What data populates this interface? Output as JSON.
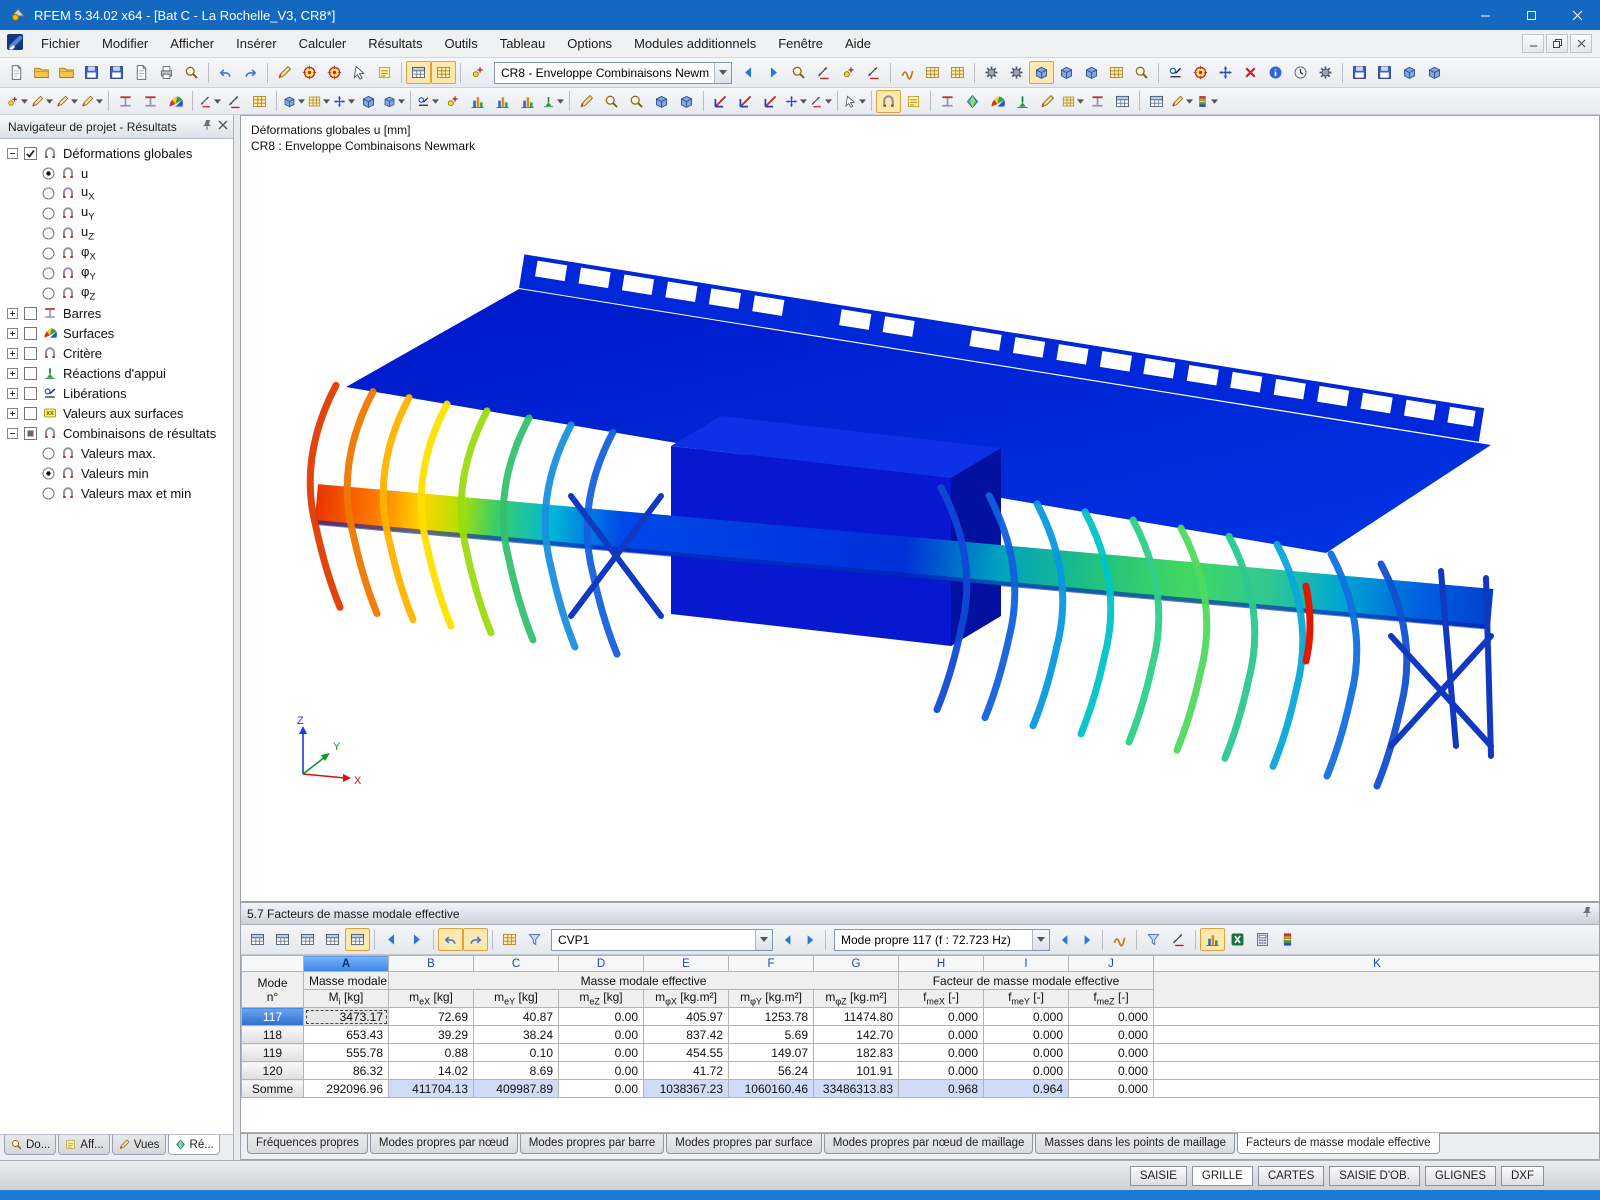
{
  "window": {
    "title": "RFEM 5.34.02 x64 - [Bat C - La Rochelle_V3, CR8*]"
  },
  "menu": {
    "items": [
      "Fichier",
      "Modifier",
      "Afficher",
      "Insérer",
      "Calculer",
      "Résultats",
      "Outils",
      "Tableau",
      "Options",
      "Modules additionnels",
      "Fenêtre",
      "Aide"
    ]
  },
  "toolbar_main": {
    "combo_value": "CR8 - Enveloppe Combinaisons Newm",
    "groups_left": [
      [
        "new-file|doc",
        "open-project|folder",
        "open-model|folder",
        "save-as|disk",
        "save|disk",
        "copy-clipboard|doc",
        "print|print",
        "print-preview|mag"
      ],
      [
        "undo|undo",
        "redo|redo"
      ],
      [
        "edit-geometry|pen",
        "zoom-by-click|target",
        "extreme-value|target",
        "select-special|cursor",
        "new-comment|note"
      ],
      [
        "show-tables|tbl|s",
        "show-grid-table|grid|s"
      ],
      [
        "regenerate-numbering|nodeP"
      ]
    ],
    "groups_right": [
      [
        "previous-load-case|navL",
        "next-load-case|navR",
        "search-object|mag",
        "extreme-values|dim",
        "snap-point|nodeP",
        "decimal-places|dim"
      ],
      [
        "result-diagrams|wave",
        "member-abacus|grid",
        "node-abacus|grid"
      ],
      [
        "generate-mesh|gear",
        "mesh-settings|gear",
        "show-mesh|cube|s",
        "mesh-quality|cube",
        "mesh-refinement|cube",
        "mesh-table|grid",
        "mesh-view|mag"
      ],
      [
        "measure|rel",
        "rotate-view|target",
        "mirror-model|move",
        "delete-results|xred",
        "model-info|info",
        "calculation-time|clockP",
        "calculation-parameters|gear"
      ],
      [
        "export-dxf|disk",
        "export-ifc|disk",
        "import-dxf|cube",
        "export-pdf|cube"
      ]
    ]
  },
  "toolbar_second": {
    "groups": [
      [
        "new-node|nodeP|d",
        "new-line|pen|d",
        "new-line-refined|pen|d",
        "new-polyline|pen|d"
      ],
      [
        "new-member|beam",
        "new-member-set|beam",
        "new-surface-member|fan"
      ],
      [
        "new-support|dim|d",
        "new-dimension|dim",
        "new-edit-frame|grid"
      ],
      [
        "new-surface|cube|d",
        "new-rect-surface|grid|d",
        "new-opening|move|d",
        "new-solid|cube",
        "new-block|cube|d"
      ],
      [
        "connect-members|rel|d",
        "insert-node|nodeP",
        "new-nodal-load|chart",
        "new-member-load|chart",
        "new-surface-load|chart",
        "generate-loads|supp|d"
      ],
      [
        "selection-brush|pen",
        "zoom-window|mag",
        "zoom-out|mag",
        "isometric-box|cube",
        "projection-box|cube"
      ],
      [
        "view-along-x|axx",
        "view-along-y|axx",
        "view-along-z|axx",
        "reverse-z-axis|move|d",
        "custom-view-angle|dim|d"
      ],
      [
        "grab-pan|cursor|d"
      ],
      [
        "show-results|arch|s",
        "result-values-beside|note"
      ],
      [
        "show-sections|beam",
        "color-kite|diam",
        "color-surfaces|fan",
        "show-supports|supp",
        "fly-through|pen",
        "partial-views|grid|d",
        "section-plane|beam",
        "result-beams|tbl"
      ],
      [
        "control-panel|tbl",
        "display-properties|pen|d",
        "color-scale|scale|d"
      ]
    ]
  },
  "navigator": {
    "title": "Navigateur de projet - Résultats",
    "tree": [
      {
        "label": "Déformations globales",
        "sub": "",
        "level": 0,
        "control": "checkbox",
        "state": "checked",
        "expander": "minus",
        "icon": "arch",
        "name": "tree-deformations-globales"
      },
      {
        "label": "u",
        "sub": "",
        "level": 1,
        "control": "radio",
        "state": "on",
        "icon": "arch",
        "name": "tree-u"
      },
      {
        "label": "u",
        "sub": "X",
        "level": 1,
        "control": "radio",
        "state": "off",
        "icon": "arch",
        "name": "tree-ux"
      },
      {
        "label": "u",
        "sub": "Y",
        "level": 1,
        "control": "radio",
        "state": "off",
        "icon": "arch",
        "name": "tree-uy"
      },
      {
        "label": "u",
        "sub": "Z",
        "level": 1,
        "control": "radio",
        "state": "off",
        "icon": "arch",
        "name": "tree-uz"
      },
      {
        "label": "φ",
        "sub": "X",
        "level": 1,
        "control": "radio",
        "state": "off",
        "icon": "arch",
        "name": "tree-phix"
      },
      {
        "label": "φ",
        "sub": "Y",
        "level": 1,
        "control": "radio",
        "state": "off",
        "icon": "arch",
        "name": "tree-phiy"
      },
      {
        "label": "φ",
        "sub": "Z",
        "level": 1,
        "control": "radio",
        "state": "off",
        "icon": "arch",
        "name": "tree-phiz"
      },
      {
        "label": "Barres",
        "sub": "",
        "level": 0,
        "control": "checkbox",
        "state": "off",
        "expander": "plus",
        "icon": "beam",
        "name": "tree-barres"
      },
      {
        "label": "Surfaces",
        "sub": "",
        "level": 0,
        "control": "checkbox",
        "state": "off",
        "expander": "plus",
        "icon": "fan",
        "name": "tree-surfaces"
      },
      {
        "label": "Critère",
        "sub": "",
        "level": 0,
        "control": "checkbox",
        "state": "off",
        "expander": "plus",
        "icon": "arch",
        "name": "tree-critere"
      },
      {
        "label": "Réactions d'appui",
        "sub": "",
        "level": 0,
        "control": "checkbox",
        "state": "off",
        "expander": "plus",
        "icon": "supp",
        "name": "tree-reactions-appui"
      },
      {
        "label": "Libérations",
        "sub": "",
        "level": 0,
        "control": "checkbox",
        "state": "off",
        "expander": "plus",
        "icon": "rel",
        "name": "tree-liberations"
      },
      {
        "label": "Valeurs aux surfaces",
        "sub": "",
        "level": 0,
        "control": "checkbox",
        "state": "off",
        "expander": "plus",
        "icon": "badge",
        "name": "tree-valeurs-surfaces"
      },
      {
        "label": "Combinaisons de résultats",
        "sub": "",
        "level": 0,
        "control": "checkbox",
        "state": "partial",
        "expander": "minus",
        "icon": "arch",
        "name": "tree-combinaisons"
      },
      {
        "label": "Valeurs max.",
        "sub": "",
        "level": 1,
        "control": "radio",
        "state": "off",
        "icon": "arch",
        "name": "tree-valeurs-max"
      },
      {
        "label": "Valeurs min",
        "sub": "",
        "level": 1,
        "control": "radio",
        "state": "on",
        "icon": "arch",
        "name": "tree-valeurs-min"
      },
      {
        "label": "Valeurs max et min",
        "sub": "",
        "level": 1,
        "control": "radio",
        "state": "off",
        "icon": "arch",
        "name": "tree-valeurs-max-min"
      }
    ],
    "tabs": [
      {
        "label": "Do...",
        "icon": "mag",
        "active": false
      },
      {
        "label": "Aff...",
        "icon": "note",
        "active": false
      },
      {
        "label": "Vues",
        "icon": "pen",
        "active": false
      },
      {
        "label": "Ré...",
        "icon": "diam",
        "active": true
      }
    ]
  },
  "viewport": {
    "caption_line1": "Déformations globales u [mm]",
    "caption_line2": "CR8 : Enveloppe Combinaisons Newmark",
    "axes": {
      "x": "X",
      "y": "Y",
      "z": "Z"
    }
  },
  "results_panel": {
    "title": "5.7 Facteurs de masse modale effective",
    "case_combo": "CVP1",
    "mode_combo": "Mode propre 117 (f : 72.723 Hz)",
    "tools_left": [
      [
        "goto-table|tbl",
        "edit-in-table|tbl",
        "insert-table-row|tbl",
        "edit-row|tbl",
        "delete-row|tbl|s"
      ],
      [
        "first-mode|navL",
        "last-mode|navR"
      ],
      [
        "previous-view|undo|s",
        "next-view|redo|s"
      ],
      [
        "table-rows|grid",
        "table-filter|funnel"
      ]
    ],
    "tools_right": [
      [
        "result-diagram|wave"
      ],
      [
        "filter-results|funnel",
        "result-relations|dim"
      ],
      [
        "histogram|chart|s",
        "export-excel|excel",
        "open-calculator|calc",
        "decimal-format|scale"
      ]
    ],
    "table": {
      "column_letters": [
        "A",
        "B",
        "C",
        "D",
        "E",
        "F",
        "G",
        "H",
        "I",
        "J",
        "K"
      ],
      "row_header_line1": "Mode",
      "row_header_line2": "n°",
      "colA_title": "Masse modale",
      "mass_group_title": "Masse modale effective",
      "factor_group_title": "Facteur de masse modale effective",
      "sub_headers": [
        {
          "base": "M",
          "sub": "i",
          "unit": "[kg]"
        },
        {
          "base": "m",
          "sub": "eX",
          "unit": "[kg]"
        },
        {
          "base": "m",
          "sub": "eY",
          "unit": "[kg]"
        },
        {
          "base": "m",
          "sub": "eZ",
          "unit": "[kg]"
        },
        {
          "base": "m",
          "sub": "φX",
          "unit": "[kg.m²]"
        },
        {
          "base": "m",
          "sub": "φY",
          "unit": "[kg.m²]"
        },
        {
          "base": "m",
          "sub": "φZ",
          "unit": "[kg.m²]"
        },
        {
          "base": "f",
          "sub": "meX",
          "unit": "[-]"
        },
        {
          "base": "f",
          "sub": "meY",
          "unit": "[-]"
        },
        {
          "base": "f",
          "sub": "meZ",
          "unit": "[-]"
        }
      ],
      "rows": [
        {
          "mode": "117",
          "selected": true,
          "values": [
            "3473.17",
            "72.69",
            "40.87",
            "0.00",
            "405.97",
            "1253.78",
            "11474.80",
            "0.000",
            "0.000",
            "0.000"
          ]
        },
        {
          "mode": "118",
          "selected": false,
          "values": [
            "653.43",
            "39.29",
            "38.24",
            "0.00",
            "837.42",
            "5.69",
            "142.70",
            "0.000",
            "0.000",
            "0.000"
          ]
        },
        {
          "mode": "119",
          "selected": false,
          "values": [
            "555.78",
            "0.88",
            "0.10",
            "0.00",
            "454.55",
            "149.07",
            "182.83",
            "0.000",
            "0.000",
            "0.000"
          ]
        },
        {
          "mode": "120",
          "selected": false,
          "values": [
            "86.32",
            "14.02",
            "8.69",
            "0.00",
            "41.72",
            "56.24",
            "101.91",
            "0.000",
            "0.000",
            "0.000"
          ]
        }
      ],
      "sum_row": {
        "label": "Somme",
        "values": [
          "292096.96",
          "411704.13",
          "409987.89",
          "0.00",
          "1038367.23",
          "1060160.46",
          "33486313.83",
          "0.968",
          "0.964",
          "0.000"
        ],
        "highlighted": [
          1,
          2,
          4,
          5,
          6,
          7,
          8
        ]
      }
    },
    "tabs": [
      "Fréquences propres",
      "Modes propres par nœud",
      "Modes propres par barre",
      "Modes propres par surface",
      "Modes propres par nœud de maillage",
      "Masses dans les points de maillage",
      "Facteurs de masse modale effective"
    ],
    "active_tab": "Facteurs de masse modale effective"
  },
  "statusbar": {
    "buttons": [
      "SAISIE",
      "GRILLE",
      "CARTES",
      "SAISIE D'OB.",
      "GLIGNES",
      "DXF"
    ],
    "active": "GRILLE"
  }
}
